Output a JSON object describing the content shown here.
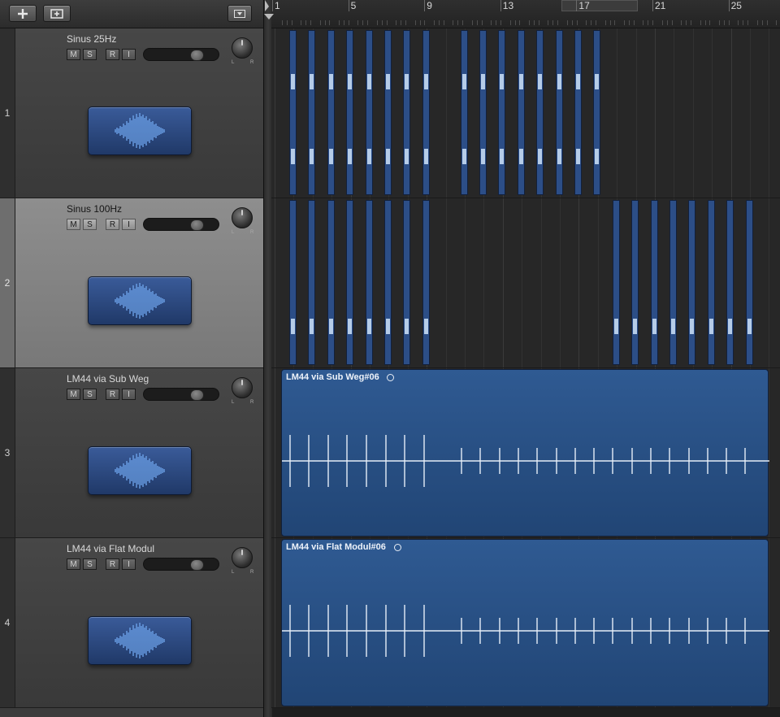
{
  "toolbar": {
    "add_track_icon": "plus-icon",
    "track_stack_icon": "stack-icon",
    "options_icon": "dropdown-icon"
  },
  "ruler": {
    "bars": [
      "1",
      "5",
      "9",
      "13",
      "17",
      "21",
      "25"
    ]
  },
  "tracks": [
    {
      "number": "1",
      "name": "Sinus 25Hz",
      "mute": "M",
      "solo": "S",
      "record": "R",
      "input": "I",
      "pan_l": "L",
      "pan_r": "R",
      "icon": "waveform-icon",
      "record_armed": false,
      "selected": false
    },
    {
      "number": "2",
      "name": "Sinus 100Hz",
      "mute": "M",
      "solo": "S",
      "record": "R",
      "input": "I",
      "pan_l": "L",
      "pan_r": "R",
      "icon": "waveform-icon",
      "record_armed": true,
      "selected": true
    },
    {
      "number": "3",
      "name": "LM44 via Sub Weg",
      "mute": "M",
      "solo": "S",
      "record": "R",
      "input": "I",
      "pan_l": "L",
      "pan_r": "R",
      "icon": "waveform-icon",
      "record_armed": false,
      "selected": false
    },
    {
      "number": "4",
      "name": "LM44 via Flat Modul",
      "mute": "M",
      "solo": "S",
      "record": "R",
      "input": "I",
      "pan_l": "L",
      "pan_r": "R",
      "icon": "waveform-icon",
      "record_armed": false,
      "selected": false
    }
  ],
  "regions": {
    "track3": "LM44 via Sub Weg#06",
    "track4": "LM44 via Flat Modul#06"
  },
  "colors": {
    "region": "#2c4e87",
    "region_highlight": "#b5cce8",
    "record_armed": "#e85040"
  }
}
